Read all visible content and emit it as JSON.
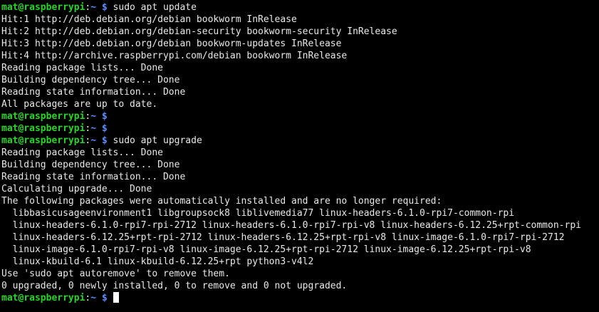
{
  "terminal": {
    "prompt_user_host": "mat@raspberrypi",
    "prompt_sep": ":",
    "prompt_path": "~",
    "prompt_symbol": " $ ",
    "lines": [
      {
        "type": "prompt",
        "command": "sudo apt update"
      },
      {
        "type": "output",
        "text": "Hit:1 http://deb.debian.org/debian bookworm InRelease"
      },
      {
        "type": "output",
        "text": "Hit:2 http://deb.debian.org/debian-security bookworm-security InRelease"
      },
      {
        "type": "output",
        "text": "Hit:3 http://deb.debian.org/debian bookworm-updates InRelease"
      },
      {
        "type": "output",
        "text": "Hit:4 http://archive.raspberrypi.com/debian bookworm InRelease"
      },
      {
        "type": "output",
        "text": "Reading package lists... Done"
      },
      {
        "type": "output",
        "text": "Building dependency tree... Done"
      },
      {
        "type": "output",
        "text": "Reading state information... Done"
      },
      {
        "type": "output",
        "text": "All packages are up to date."
      },
      {
        "type": "prompt",
        "command": ""
      },
      {
        "type": "prompt",
        "command": ""
      },
      {
        "type": "prompt",
        "command": "sudo apt upgrade"
      },
      {
        "type": "output",
        "text": "Reading package lists... Done"
      },
      {
        "type": "output",
        "text": "Building dependency tree... Done"
      },
      {
        "type": "output",
        "text": "Reading state information... Done"
      },
      {
        "type": "output",
        "text": "Calculating upgrade... Done"
      },
      {
        "type": "output",
        "text": "The following packages were automatically installed and are no longer required:"
      },
      {
        "type": "output",
        "text": "  libbasicusageenvironment1 libgroupsock8 liblivemedia77 linux-headers-6.1.0-rpi7-common-rpi"
      },
      {
        "type": "output",
        "text": "  linux-headers-6.1.0-rpi7-rpi-2712 linux-headers-6.1.0-rpi7-rpi-v8 linux-headers-6.12.25+rpt-common-rpi"
      },
      {
        "type": "output",
        "text": "  linux-headers-6.12.25+rpt-rpi-2712 linux-headers-6.12.25+rpt-rpi-v8 linux-image-6.1.0-rpi7-rpi-2712"
      },
      {
        "type": "output",
        "text": "  linux-image-6.1.0-rpi7-rpi-v8 linux-image-6.12.25+rpt-rpi-2712 linux-image-6.12.25+rpt-rpi-v8"
      },
      {
        "type": "output",
        "text": "  linux-kbuild-6.1 linux-kbuild-6.12.25+rpt python3-v4l2"
      },
      {
        "type": "output",
        "text": "Use 'sudo apt autoremove' to remove them."
      },
      {
        "type": "output",
        "text": "0 upgraded, 0 newly installed, 0 to remove and 0 not upgraded."
      },
      {
        "type": "prompt",
        "command": "",
        "cursor": true
      }
    ]
  },
  "colors": {
    "background": "#000000",
    "foreground": "#e8e8e8",
    "user_host": "#27d627",
    "path": "#5c8cff"
  }
}
